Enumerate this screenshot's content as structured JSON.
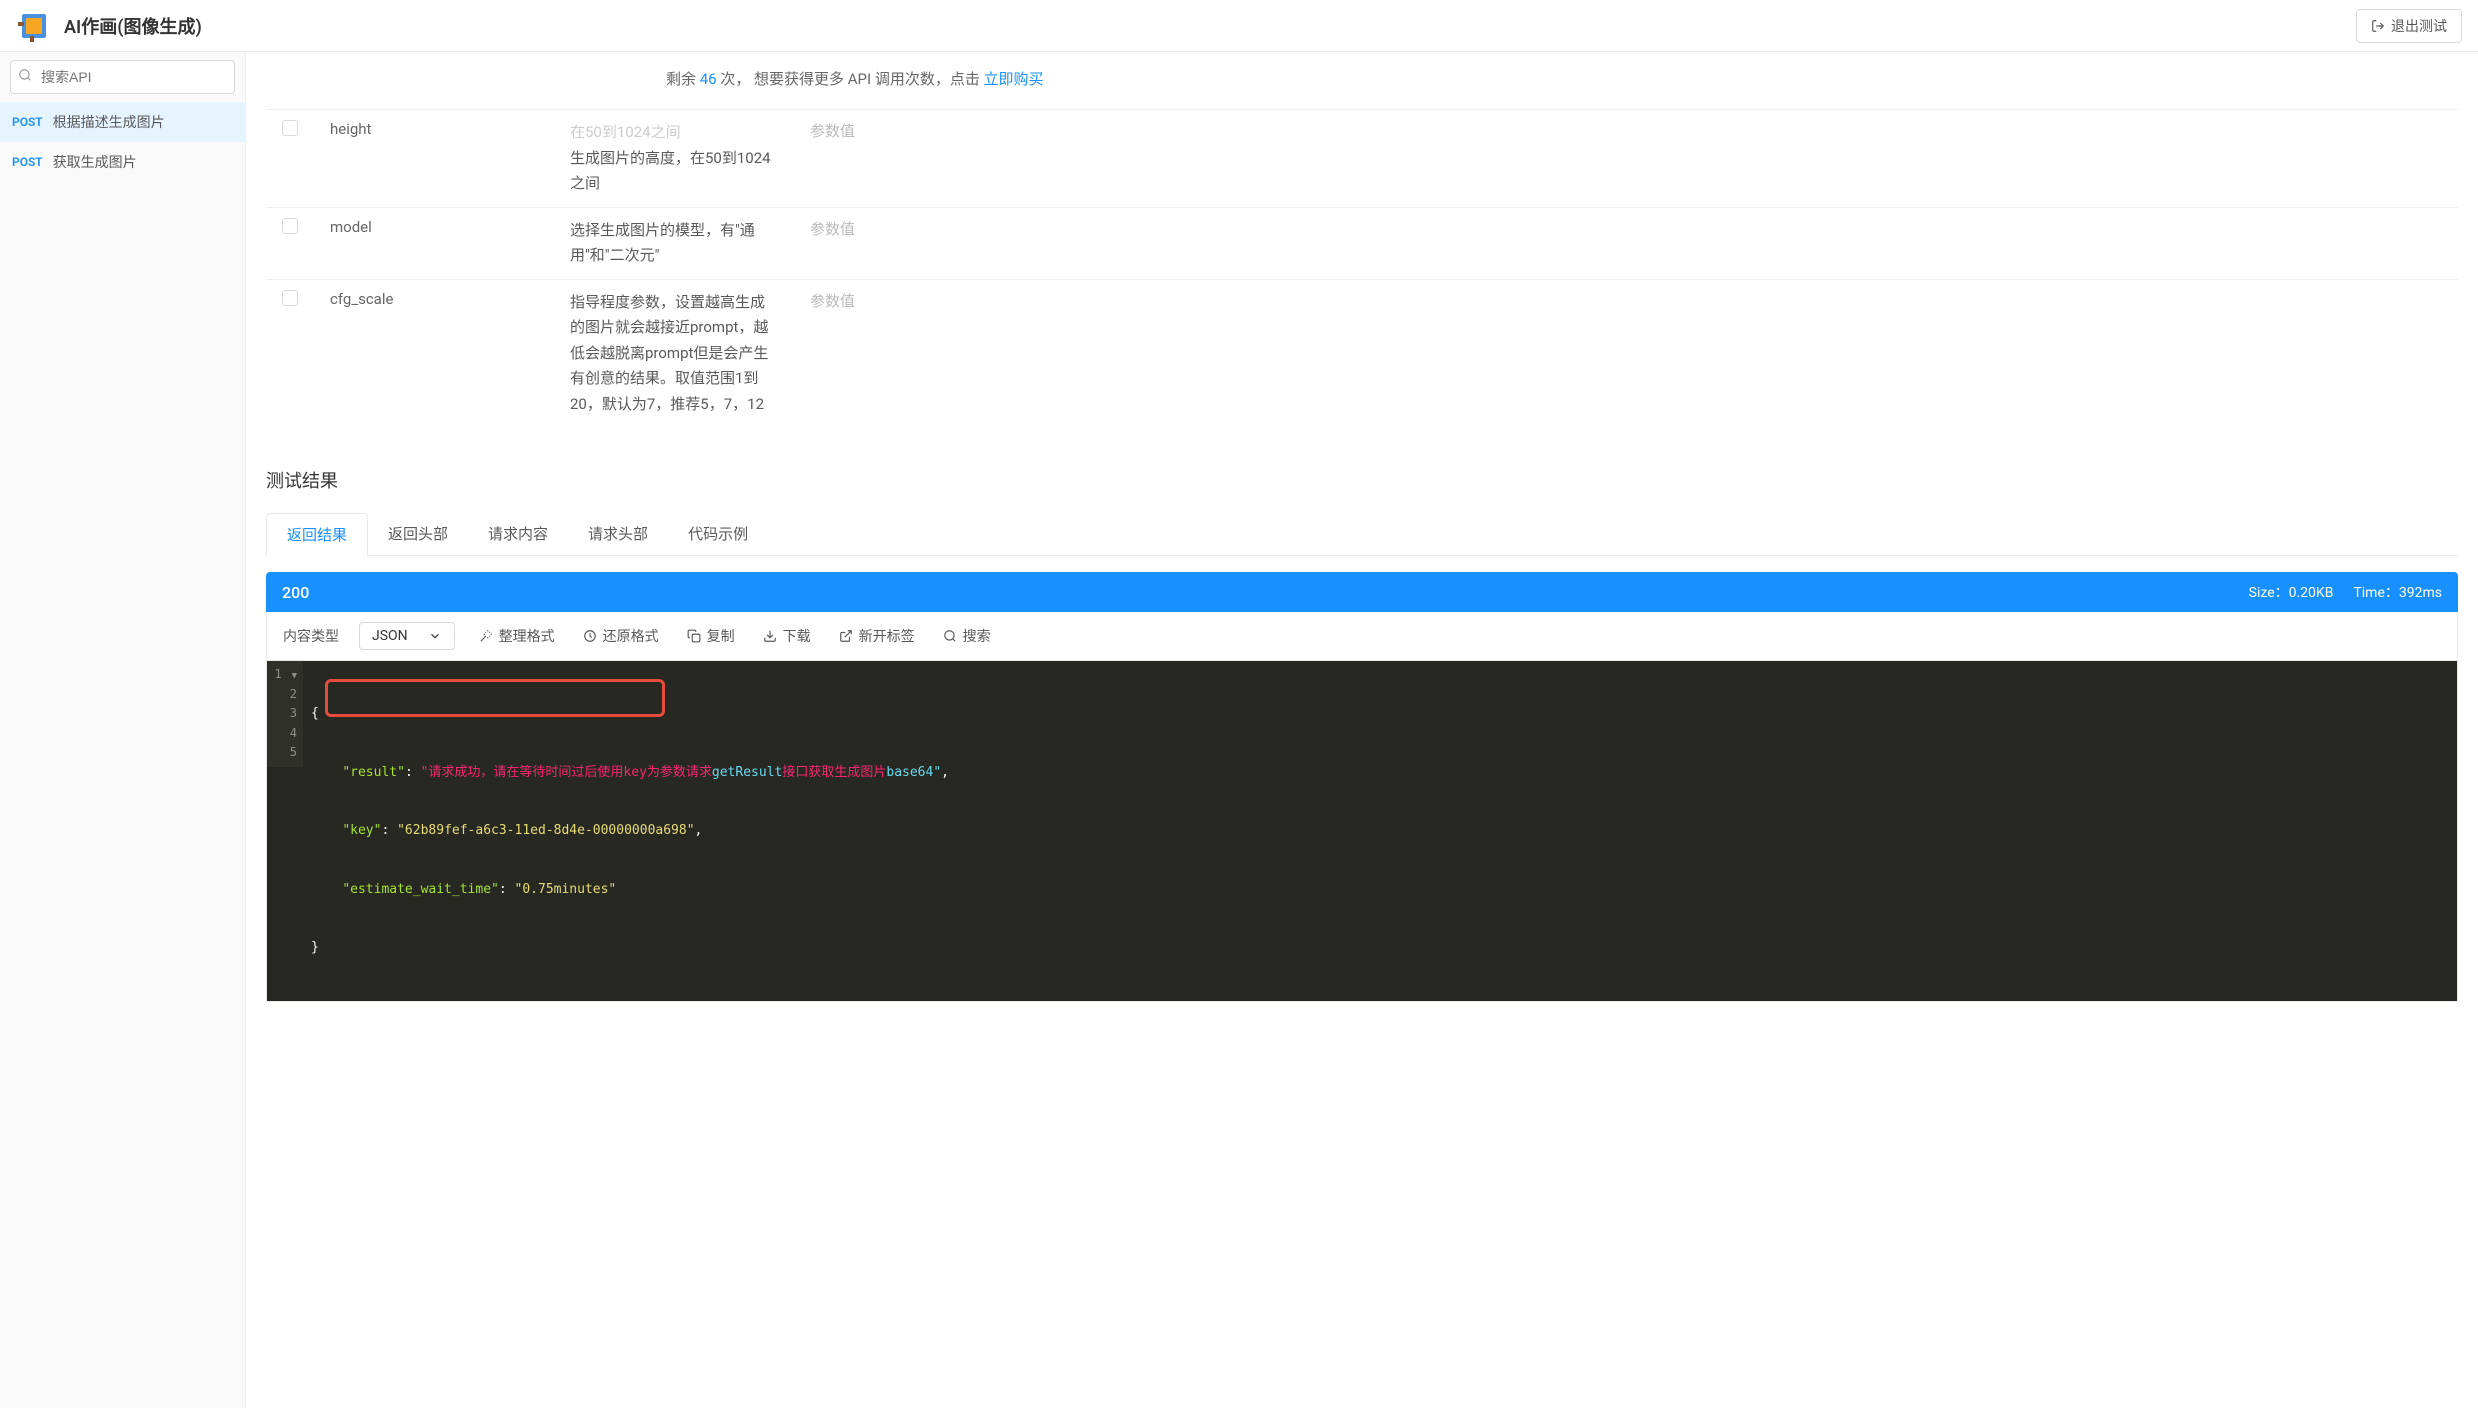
{
  "header": {
    "title": "AI作画(图像生成)",
    "exit_label": "退出测试"
  },
  "sidebar": {
    "search_placeholder": "搜索API",
    "items": [
      {
        "method": "POST",
        "label": "根据描述生成图片",
        "active": true
      },
      {
        "method": "POST",
        "label": "获取生成图片",
        "active": false
      }
    ]
  },
  "notice": {
    "prefix": "剩余 ",
    "count": "46",
    "mid": " 次， 想要获得更多 API 调用次数，点击 ",
    "link": "立即购买"
  },
  "params": [
    {
      "name": "",
      "desc_partial": "在50到1024之间",
      "value": ""
    },
    {
      "name": "height",
      "desc": "生成图片的高度，在50到1024之间",
      "value_placeholder": "参数值"
    },
    {
      "name": "model",
      "desc": "选择生成图片的模型，有\"通用\"和\"二次元\"",
      "value_placeholder": "参数值"
    },
    {
      "name": "cfg_scale",
      "desc": "指导程度参数，设置越高生成的图片就会越接近prompt，越低会越脱离prompt但是会产生有创意的结果。取值范围1到20，默认为7，推荐5，7，12",
      "value_placeholder": "参数值"
    }
  ],
  "result": {
    "section_title": "测试结果",
    "tabs": [
      {
        "label": "返回结果",
        "active": true
      },
      {
        "label": "返回头部",
        "active": false
      },
      {
        "label": "请求内容",
        "active": false
      },
      {
        "label": "请求头部",
        "active": false
      },
      {
        "label": "代码示例",
        "active": false
      }
    ],
    "status": {
      "code": "200",
      "size_label": "Size：0.20KB",
      "time_label": "Time：392ms"
    },
    "toolbar": {
      "content_type_label": "内容类型",
      "format_select": "JSON",
      "format_btn": "整理格式",
      "restore_btn": "还原格式",
      "copy_btn": "复制",
      "download_btn": "下载",
      "newtab_btn": "新开标签",
      "search_btn": "搜索"
    },
    "code": {
      "result_key": "\"result\"",
      "result_val_cn": "\"请求成功，请在等待时间过后使用key为参数请求",
      "result_val_en1": "getResult",
      "result_val_cn2": "接口获取生成图片",
      "result_val_en2": "base64\"",
      "key_key": "\"key\"",
      "key_val": "\"62b89fef-a6c3-11ed-8d4e-00000000a698\"",
      "wait_key": "\"estimate_wait_time\"",
      "wait_val": "\"0.75minutes\""
    }
  }
}
